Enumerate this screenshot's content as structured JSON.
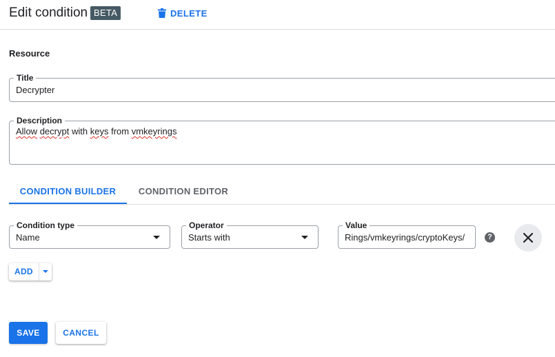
{
  "header": {
    "title": "Edit condition",
    "badge": "BETA",
    "delete_label": "DELETE",
    "delete_icon": "trash-icon"
  },
  "resource": {
    "label": "Resource"
  },
  "title_field": {
    "label": "Title",
    "value": "Decrypter"
  },
  "description_field": {
    "label": "Description",
    "value_words": [
      "Allow",
      "decrypt",
      "with",
      "keys",
      "from",
      "vmkeyrings"
    ]
  },
  "tabs": [
    {
      "label": "CONDITION BUILDER",
      "active": true
    },
    {
      "label": "CONDITION EDITOR",
      "active": false
    }
  ],
  "condition": {
    "type_label": "Condition type",
    "type_value": "Name",
    "operator_label": "Operator",
    "operator_value": "Starts with",
    "value_label": "Value",
    "value_visible": "Rings/vmkeyrings/cryptoKeys/",
    "help_icon": "help-icon",
    "help_glyph": "?",
    "remove_icon": "close-icon"
  },
  "add_button": {
    "label": "ADD"
  },
  "footer": {
    "save_label": "SAVE",
    "cancel_label": "CANCEL"
  },
  "colors": {
    "accent": "#1a73e8",
    "badge_bg": "#455a64",
    "border": "#9aa0a6",
    "divider": "#dadce0"
  }
}
